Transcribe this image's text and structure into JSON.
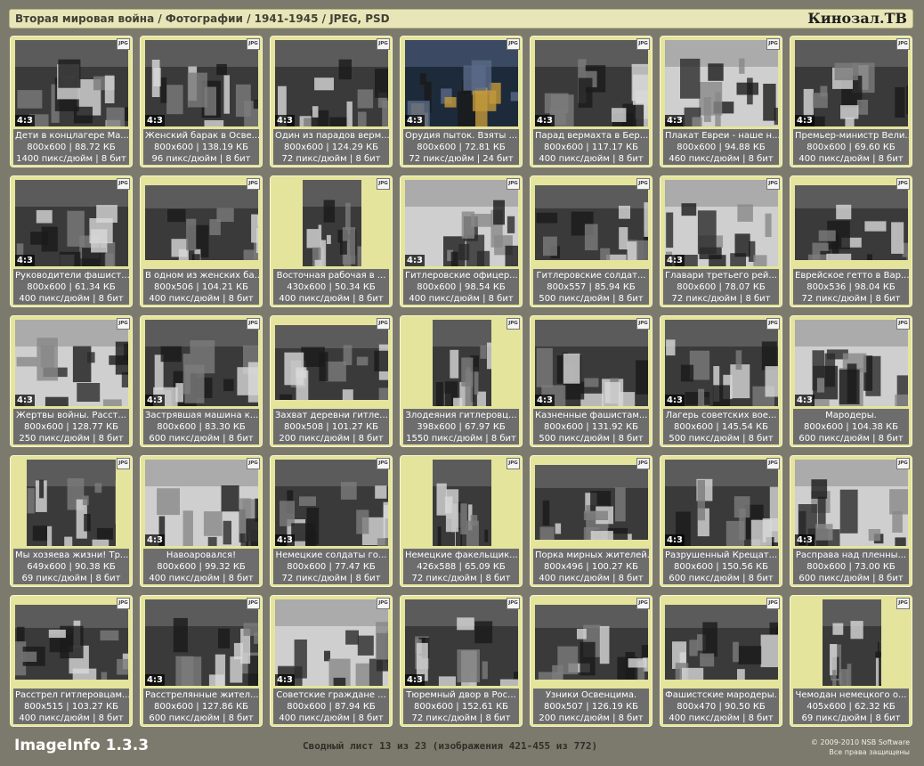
{
  "header": {
    "title": "Вторая мировая война / Фотографии / 1941-1945 / JPEG, PSD",
    "brand": "Кинозал.ТВ"
  },
  "icons": {
    "file_type": "JPG"
  },
  "tiles": [
    {
      "name": "Дети в концлагере Ма...",
      "size": "800x600 | 88.72 КБ",
      "meta": "1400 пикс/дюйм | 8 бит",
      "ratio": "4:3",
      "thumb": "full"
    },
    {
      "name": "Женский барак в Осве...",
      "size": "800x600 | 138.19 КБ",
      "meta": "96 пикс/дюйм | 8 бит",
      "ratio": "4:3",
      "thumb": "full"
    },
    {
      "name": "Один из парадов верм...",
      "size": "800x600 | 124.29 КБ",
      "meta": "72 пикс/дюйм | 8 бит",
      "ratio": "4:3",
      "thumb": "full"
    },
    {
      "name": "Орудия пыток. Взяты ...",
      "size": "800x600 | 72.81 КБ",
      "meta": "72 пикс/дюйм | 24 бит",
      "ratio": "4:3",
      "thumb": "color"
    },
    {
      "name": "Парад вермахта в Бер...",
      "size": "800x600 | 117.17 КБ",
      "meta": "400 пикс/дюйм | 8 бит",
      "ratio": "4:3",
      "thumb": "full"
    },
    {
      "name": "Плакат Евреи - наше н...",
      "size": "800x600 | 94.88 КБ",
      "meta": "460 пикс/дюйм | 8 бит",
      "ratio": "4:3",
      "thumb": "light"
    },
    {
      "name": "Премьер-министр Вели...",
      "size": "800x600 | 69.60 КБ",
      "meta": "400 пикс/дюйм | 8 бит",
      "ratio": "4:3",
      "thumb": "full"
    },
    {
      "name": "Руководители фашист...",
      "size": "800x600 | 61.34 КБ",
      "meta": "400 пикс/дюйм | 8 бит",
      "ratio": "4:3",
      "thumb": "full"
    },
    {
      "name": "В одном из женских ба...",
      "size": "800x506 | 104.21 КБ",
      "meta": "400 пикс/дюйм | 8 бит",
      "ratio": "",
      "thumb": "wide"
    },
    {
      "name": "Восточная рабочая в ...",
      "size": "430x600 | 50.34 КБ",
      "meta": "400 пикс/дюйм | 8 бит",
      "ratio": "",
      "thumb": "tall"
    },
    {
      "name": "Гитлеровские офицер...",
      "size": "800x600 | 98.54 КБ",
      "meta": "400 пикс/дюйм | 8 бит",
      "ratio": "4:3",
      "thumb": "light"
    },
    {
      "name": "Гитлеровские солдат...",
      "size": "800x557 | 85.94 КБ",
      "meta": "500 пикс/дюйм | 8 бит",
      "ratio": "",
      "thumb": "wide"
    },
    {
      "name": "Главари третьего рей...",
      "size": "800x600 | 78.07 КБ",
      "meta": "72 пикс/дюйм | 8 бит",
      "ratio": "4:3",
      "thumb": "light"
    },
    {
      "name": "Еврейское гетто в Вар...",
      "size": "800x536 | 98.04 КБ",
      "meta": "72 пикс/дюйм | 8 бит",
      "ratio": "",
      "thumb": "wide"
    },
    {
      "name": "Жертвы войны. Расст...",
      "size": "800x600 | 128.77 КБ",
      "meta": "250 пикс/дюйм | 8 бит",
      "ratio": "4:3",
      "thumb": "light"
    },
    {
      "name": "Застрявшая машина к...",
      "size": "800x600 | 83.30 КБ",
      "meta": "600 пикс/дюйм | 8 бит",
      "ratio": "4:3",
      "thumb": "full"
    },
    {
      "name": "Захват деревни гитле...",
      "size": "800x508 | 101.27 КБ",
      "meta": "200 пикс/дюйм | 8 бит",
      "ratio": "",
      "thumb": "wide"
    },
    {
      "name": "Злодеяния гитлеровц...",
      "size": "398x600 | 67.97 КБ",
      "meta": "1550 пикс/дюйм | 8 бит",
      "ratio": "",
      "thumb": "tall"
    },
    {
      "name": "Казненные фашистам...",
      "size": "800x600 | 131.92 КБ",
      "meta": "500 пикс/дюйм | 8 бит",
      "ratio": "4:3",
      "thumb": "full"
    },
    {
      "name": "Лагерь советских вое...",
      "size": "800x600 | 145.54 КБ",
      "meta": "500 пикс/дюйм | 8 бит",
      "ratio": "4:3",
      "thumb": "full"
    },
    {
      "name": "Мародеры.",
      "size": "800x600 | 104.38 КБ",
      "meta": "600 пикс/дюйм | 8 бит",
      "ratio": "4:3",
      "thumb": "light"
    },
    {
      "name": "Мы хозяева жизни! Тр...",
      "size": "649x600 | 90.38 КБ",
      "meta": "69 пикс/дюйм | 8 бит",
      "ratio": "",
      "thumb": "midtall"
    },
    {
      "name": "Навоаровался!",
      "size": "800x600 | 99.32 КБ",
      "meta": "400 пикс/дюйм | 8 бит",
      "ratio": "4:3",
      "thumb": "light"
    },
    {
      "name": "Немецкие солдаты го...",
      "size": "800x600 | 77.47 КБ",
      "meta": "72 пикс/дюйм | 8 бит",
      "ratio": "4:3",
      "thumb": "full"
    },
    {
      "name": "Немецкие факельщик...",
      "size": "426x588 | 65.09 КБ",
      "meta": "72 пикс/дюйм | 8 бит",
      "ratio": "",
      "thumb": "tall"
    },
    {
      "name": "Порка мирных жителей.",
      "size": "800x496 | 100.27 КБ",
      "meta": "400 пикс/дюйм | 8 бит",
      "ratio": "",
      "thumb": "wide"
    },
    {
      "name": "Разрушенный Крещат...",
      "size": "800x600 | 150.56 КБ",
      "meta": "600 пикс/дюйм | 8 бит",
      "ratio": "4:3",
      "thumb": "full"
    },
    {
      "name": "Расправа над пленны...",
      "size": "800x600 | 73.00 КБ",
      "meta": "600 пикс/дюйм | 8 бит",
      "ratio": "4:3",
      "thumb": "light"
    },
    {
      "name": "Расстрел гитлеровцам...",
      "size": "800x515 | 103.27 КБ",
      "meta": "400 пикс/дюйм | 8 бит",
      "ratio": "",
      "thumb": "wide"
    },
    {
      "name": "Расстрелянные жител...",
      "size": "800x600 | 127.86 КБ",
      "meta": "600 пикс/дюйм | 8 бит",
      "ratio": "4:3",
      "thumb": "full"
    },
    {
      "name": "Советские граждане ...",
      "size": "800x600 | 87.94 КБ",
      "meta": "400 пикс/дюйм | 8 бит",
      "ratio": "4:3",
      "thumb": "light"
    },
    {
      "name": "Тюремный двор в Рос...",
      "size": "800x600 | 152.61 КБ",
      "meta": "72 пикс/дюйм | 8 бит",
      "ratio": "4:3",
      "thumb": "full"
    },
    {
      "name": "Узники Освенцима.",
      "size": "800x507 | 126.19 КБ",
      "meta": "200 пикс/дюйм | 8 бит",
      "ratio": "",
      "thumb": "wide"
    },
    {
      "name": "Фашистские мародеры.",
      "size": "800x470 | 90.50 КБ",
      "meta": "400 пикс/дюйм | 8 бит",
      "ratio": "",
      "thumb": "wide"
    },
    {
      "name": "Чемодан немецкого о...",
      "size": "405x600 | 62.32 КБ",
      "meta": "69 пикс/дюйм | 8 бит",
      "ratio": "",
      "thumb": "tall"
    }
  ],
  "footer": {
    "app": "ImageInfo 1.3.3",
    "sheet": "Сводный лист 13 из 23 (изображения 421-455 из 772)",
    "copyright": "© 2009-2010 NSB Software",
    "rights": "Все права защищены"
  }
}
